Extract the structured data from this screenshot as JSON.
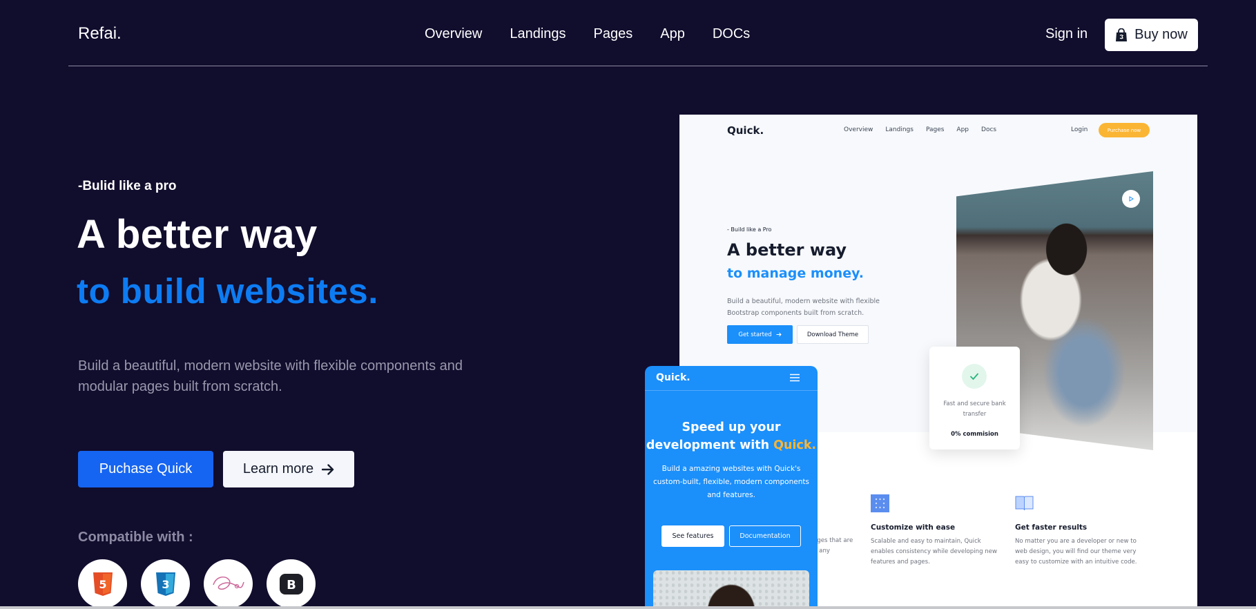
{
  "nav": {
    "brand": "Refai.",
    "links": [
      "Overview",
      "Landings",
      "Pages",
      "App",
      "DOCs"
    ],
    "signin": "Sign in",
    "buy": "Buy now",
    "buy_icon": "shopping-bag-icon"
  },
  "hero": {
    "eyebrow": "-Bulid like a pro",
    "title_line1": "A better way",
    "title_line2": "to build websites.",
    "description": "Build a beautiful, modern website with flexible components and modular pages built from scratch.",
    "primary_button": "Puchase Quick",
    "secondary_button": "Learn more",
    "compatible_label": "Compatible with :",
    "compatible_icons": [
      "html5-icon",
      "css3-icon",
      "sass-icon",
      "bootstrap-icon"
    ]
  },
  "preview": {
    "logo": "Quick.",
    "nav": [
      "Overview",
      "Landings",
      "Pages",
      "App",
      "Docs"
    ],
    "login": "Login",
    "purchase": "Purchase now",
    "eyebrow": "- Build like a Pro",
    "title": "A better way",
    "subtitle": "to manage money.",
    "description": "Build a beautiful, modern website with flexible Bootstrap components built from scratch.",
    "get_started": "Get started",
    "download": "Download Theme",
    "card_text": "Fast and secure bank transfer",
    "card_strong": "0% commision",
    "partial_text": "ages that are\nn any",
    "features": [
      {
        "title": "Customize with ease",
        "description": "Scalable and easy to maintain, Quick enables consistency while developing new features and pages."
      },
      {
        "title": "Get faster results",
        "description": "No matter you are a developer or new to web design, you will find our theme very easy to customize with an intuitive code."
      }
    ]
  },
  "mobile": {
    "logo": "Quick.",
    "title_line1": "Speed up your",
    "title_line2_prefix": "development with ",
    "title_line2_highlight": "Quick.",
    "description": "Build a amazing websites with Quick's custom-built, flexible, modern components and features.",
    "btn_features": "See features",
    "btn_docs": "Documentation"
  },
  "colors": {
    "background": "#110d2d",
    "accent_blue": "#0d7cf3",
    "button_blue": "#1665f2",
    "quick_blue": "#1b8ffa",
    "quick_yellow": "#fbb534"
  }
}
